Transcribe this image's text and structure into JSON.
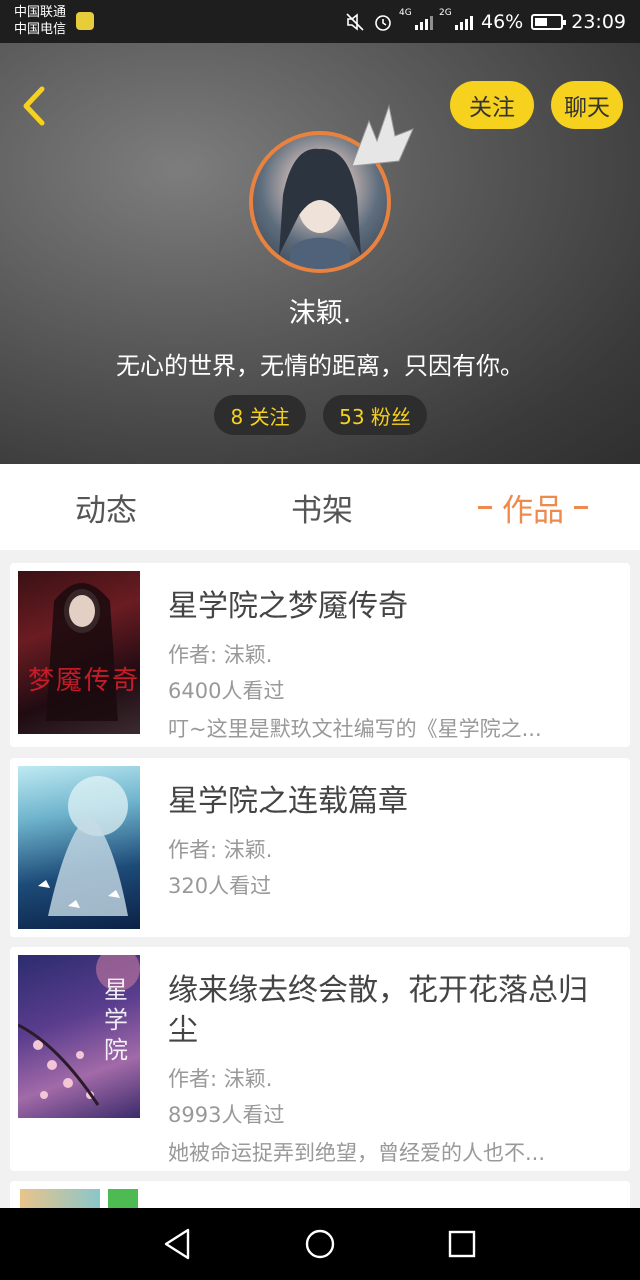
{
  "status_bar": {
    "carrier_1": "中国联通",
    "carrier_2": "中国电信",
    "network_1": "4G",
    "network_2": "2G",
    "battery": "46%",
    "time": "23:09"
  },
  "profile": {
    "follow_button": "关注",
    "chat_button": "聊天",
    "username": "沫颖.",
    "signature": "无心的世界，无情的距离，只因有你。",
    "following": "8 关注",
    "fans": "53 粉丝"
  },
  "tabs": [
    {
      "label": "动态",
      "active": false
    },
    {
      "label": "书架",
      "active": false
    },
    {
      "label": "作品",
      "active": true
    }
  ],
  "works": [
    {
      "title": "星学院之梦魇传奇",
      "author": "作者: 沫颖.",
      "views": "6400人看过",
      "desc": "叮~这里是默玖文社编写的《星学院之...",
      "cover_text": "梦魇传奇"
    },
    {
      "title": "星学院之连载篇章",
      "author": "作者: 沫颖.",
      "views": "320人看过"
    },
    {
      "title": "缘来缘去终会散，花开花落总归尘",
      "author": "作者: 沫颖.",
      "views": "8993人看过",
      "desc": "她被命运捉弄到绝望，曾经爱的人也不...",
      "cover_text": "星学院"
    }
  ],
  "colors": {
    "accent_yellow": "#f6d11d",
    "accent_orange": "#ee8a4d"
  }
}
